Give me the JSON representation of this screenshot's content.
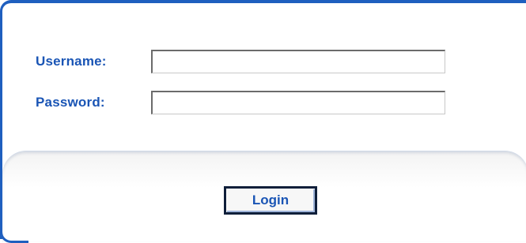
{
  "form": {
    "username": {
      "label": "Username:",
      "value": "",
      "placeholder": ""
    },
    "password": {
      "label": "Password:",
      "value": "",
      "placeholder": ""
    }
  },
  "actions": {
    "login_label": "Login"
  },
  "colors": {
    "accent": "#1f5fbf",
    "label_text": "#1a55b5"
  }
}
